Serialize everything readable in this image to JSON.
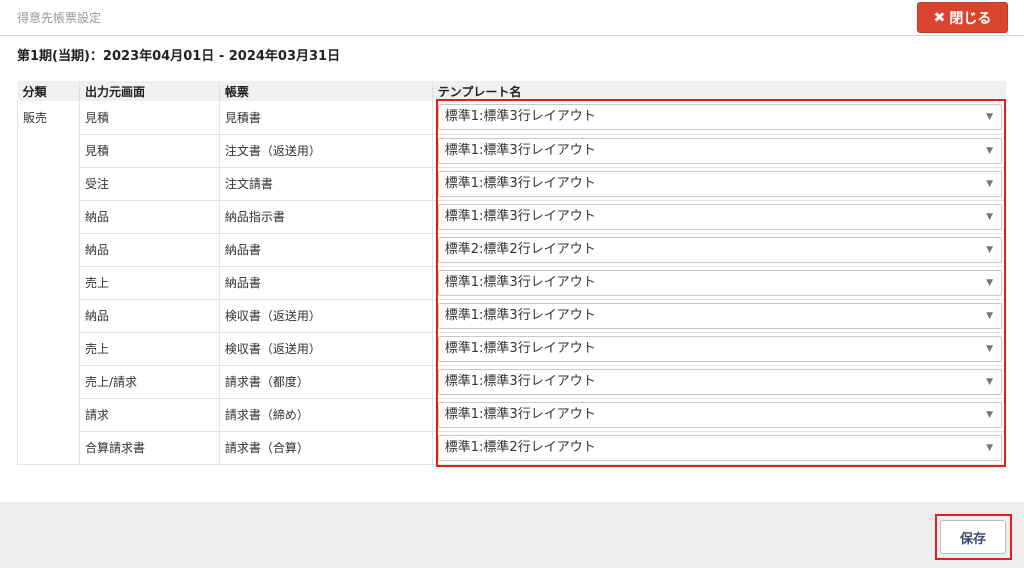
{
  "header": {
    "title": "得意先帳票設定",
    "close_label": "閉じる",
    "close_icon": "x-icon"
  },
  "period": "第1期(当期)：2023年04月01日 - 2024年03月31日",
  "table": {
    "headers": {
      "category": "分類",
      "source_screen": "出力元画面",
      "form": "帳票",
      "template": "テンプレート名"
    },
    "category": "販売",
    "rows": [
      {
        "source": "見積",
        "form": "見積書",
        "template": "標準1:標準3行レイアウト"
      },
      {
        "source": "見積",
        "form": "注文書（返送用）",
        "template": "標準1:標準3行レイアウト"
      },
      {
        "source": "受注",
        "form": "注文請書",
        "template": "標準1:標準3行レイアウト"
      },
      {
        "source": "納品",
        "form": "納品指示書",
        "template": "標準1:標準3行レイアウト"
      },
      {
        "source": "納品",
        "form": "納品書",
        "template": "標準2:標準2行レイアウト"
      },
      {
        "source": "売上",
        "form": "納品書",
        "template": "標準1:標準3行レイアウト"
      },
      {
        "source": "納品",
        "form": "検収書（返送用）",
        "template": "標準1:標準3行レイアウト"
      },
      {
        "source": "売上",
        "form": "検収書（返送用）",
        "template": "標準1:標準3行レイアウト"
      },
      {
        "source": "売上/請求",
        "form": "請求書（都度）",
        "template": "標準1:標準3行レイアウト"
      },
      {
        "source": "請求",
        "form": "請求書（締め）",
        "template": "標準1:標準3行レイアウト"
      },
      {
        "source": "合算請求書",
        "form": "請求書（合算）",
        "template": "標準1:標準2行レイアウト"
      }
    ]
  },
  "footer": {
    "save_label": "保存"
  },
  "colors": {
    "close_button": "#d9452f",
    "highlight": "#e0201f",
    "footer_bg": "#efeded"
  }
}
